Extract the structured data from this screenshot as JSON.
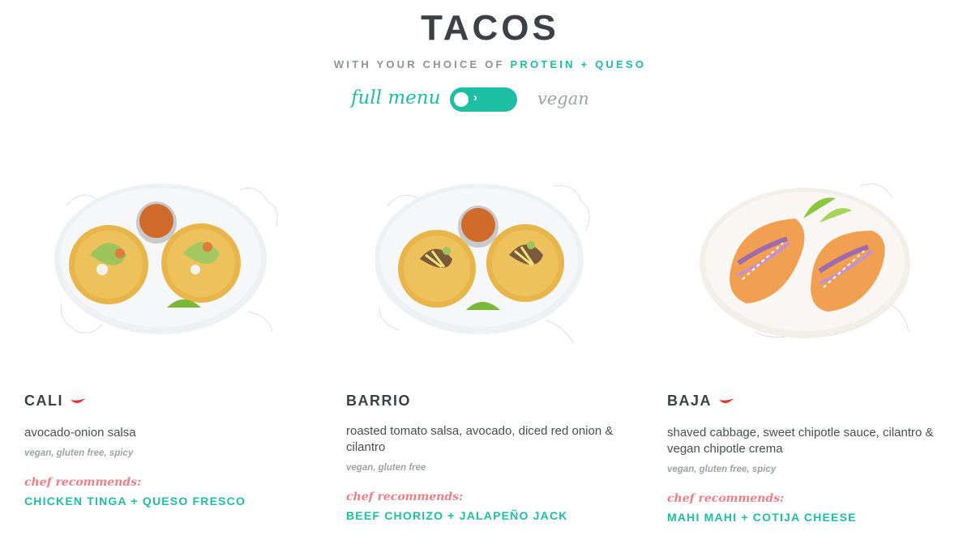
{
  "header": {
    "title": "TACOS",
    "subtitle_prefix": "WITH YOUR CHOICE OF ",
    "subtitle_accent": "PROTEIN + QUESO"
  },
  "toggle": {
    "left_label": "full menu",
    "right_label": "vegan",
    "state": "full menu"
  },
  "colors": {
    "accent": "#1ebea5",
    "recommend": "#ee7f88",
    "text": "#3d4045",
    "muted": "#9ea1a5"
  },
  "dishes": [
    {
      "name": "CALI",
      "spicy": true,
      "description": "avocado-onion salsa",
      "tags": "vegan, gluten free, spicy",
      "recommend_label": "chef recommends:",
      "recommendation": "CHICKEN TINGA + QUESO FRESCO"
    },
    {
      "name": "BARRIO",
      "spicy": false,
      "description": "roasted tomato salsa, avocado, diced red onion & cilantro",
      "tags": "vegan, gluten free",
      "recommend_label": "chef recommends:",
      "recommendation": "BEEF CHORIZO + JALAPEÑO JACK"
    },
    {
      "name": "BAJA",
      "spicy": true,
      "description": "shaved cabbage, sweet chipotle sauce, cilantro & vegan chipotle crema",
      "tags": "vegan, gluten free, spicy",
      "recommend_label": "chef recommends:",
      "recommendation": "MAHI MAHI + COTIJA CHEESE"
    }
  ]
}
